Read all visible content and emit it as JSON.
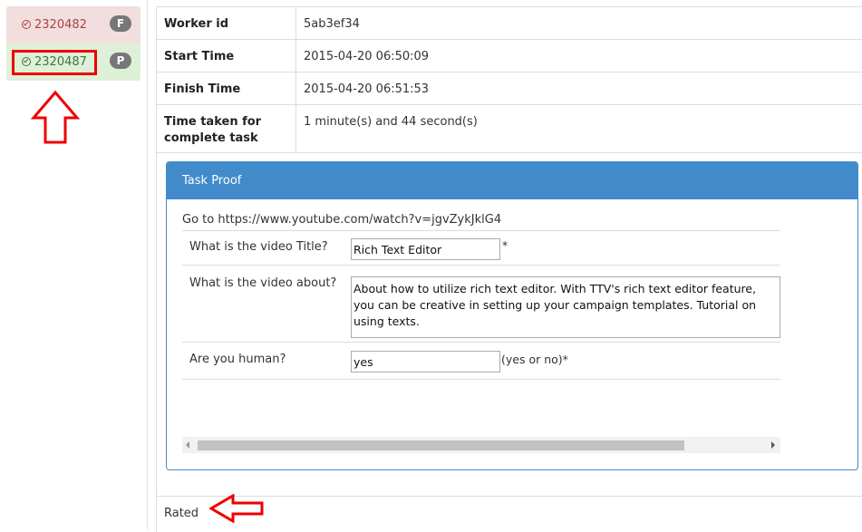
{
  "sidebar": {
    "tasks": [
      {
        "id": "2320482",
        "badge": "F",
        "status": "failed"
      },
      {
        "id": "2320487",
        "badge": "P",
        "status": "passed"
      }
    ]
  },
  "details": [
    {
      "key": "Worker id",
      "value": "5ab3ef34"
    },
    {
      "key": "Start Time",
      "value": "2015-04-20 06:50:09"
    },
    {
      "key": "Finish Time",
      "value": "2015-04-20 06:51:53"
    },
    {
      "key": "Time taken for complete task",
      "value": "1 minute(s) and 44 second(s)"
    }
  ],
  "proof": {
    "title": "Task Proof",
    "goto": "Go to https://www.youtube.com/watch?v=jgvZykJklG4",
    "q1": {
      "label": "What is the video Title?",
      "value": "Rich Text Editor",
      "hint": "*"
    },
    "q2": {
      "label": "What is the video about?",
      "value": "About how to utilize rich text editor. With TTV's rich text editor feature, you can be creative in setting up your campaign templates. Tutorial on using texts."
    },
    "q3": {
      "label": "Are you human?",
      "value": "yes",
      "hint": "(yes or no)*"
    }
  },
  "footer": {
    "status": "Rated"
  },
  "colors": {
    "annotation": "#e00000",
    "panel_header": "#428bca",
    "failed_bg": "#f2dede",
    "passed_bg": "#dff0d8"
  }
}
